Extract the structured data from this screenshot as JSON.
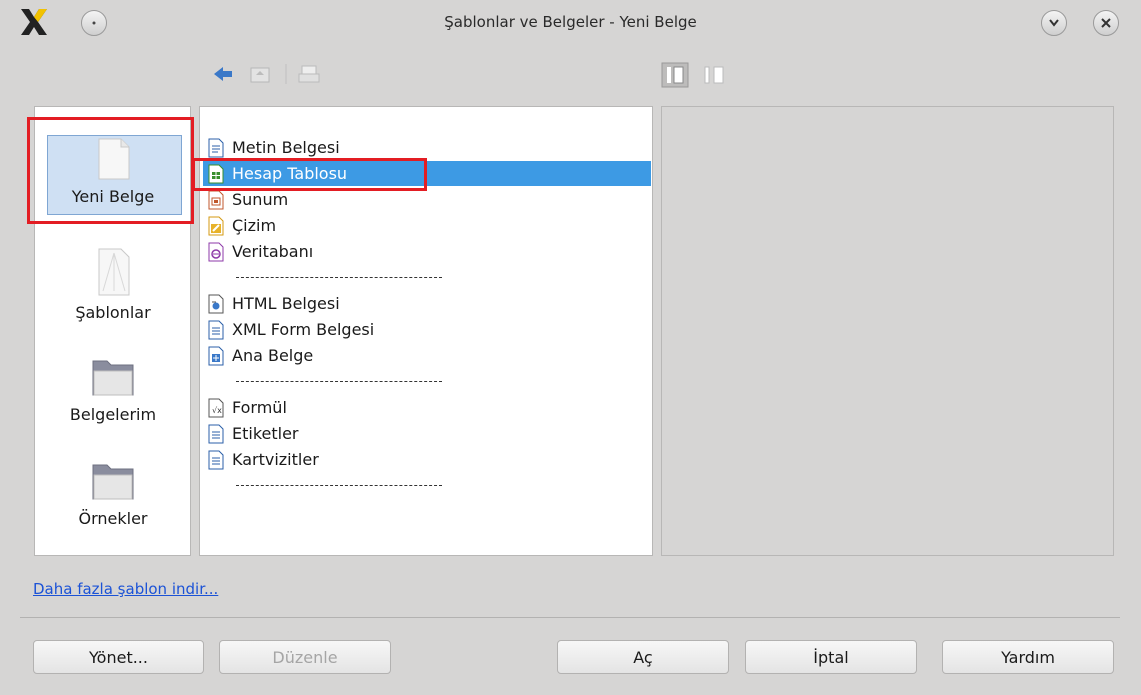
{
  "window": {
    "title": "Şablonlar ve Belgeler - Yeni Belge"
  },
  "nav": [
    {
      "label": "Yeni Belge",
      "icon": "blank-document-icon",
      "selected": true
    },
    {
      "label": "Şablonlar",
      "icon": "templates-icon",
      "selected": false
    },
    {
      "label": "Belgelerim",
      "icon": "folder-icon",
      "selected": false
    },
    {
      "label": "Örnekler",
      "icon": "folder-icon",
      "selected": false
    }
  ],
  "list": {
    "items": [
      {
        "label": "Metin Belgesi",
        "icon": "writer-icon"
      },
      {
        "label": "Hesap Tablosu",
        "icon": "calc-icon",
        "selected": true
      },
      {
        "label": "Sunum",
        "icon": "impress-icon"
      },
      {
        "label": "Çizim",
        "icon": "draw-icon"
      },
      {
        "label": "Veritabanı",
        "icon": "base-icon"
      },
      {
        "label": "HTML Belgesi",
        "icon": "html-icon"
      },
      {
        "label": "XML Form Belgesi",
        "icon": "xml-form-icon"
      },
      {
        "label": "Ana Belge",
        "icon": "master-document-icon"
      },
      {
        "label": "Formül",
        "icon": "math-icon"
      },
      {
        "label": "Etiketler",
        "icon": "labels-icon"
      },
      {
        "label": "Kartvizitler",
        "icon": "business-cards-icon"
      }
    ]
  },
  "link": {
    "label": "Daha fazla şablon indir..."
  },
  "buttons": {
    "manage": "Yönet...",
    "edit": "Düzenle",
    "open": "Aç",
    "cancel": "İptal",
    "help": "Yardım"
  },
  "colors": {
    "selection": "#3d9ae4",
    "highlight_box": "#e31d23",
    "link": "#1b52d6"
  }
}
